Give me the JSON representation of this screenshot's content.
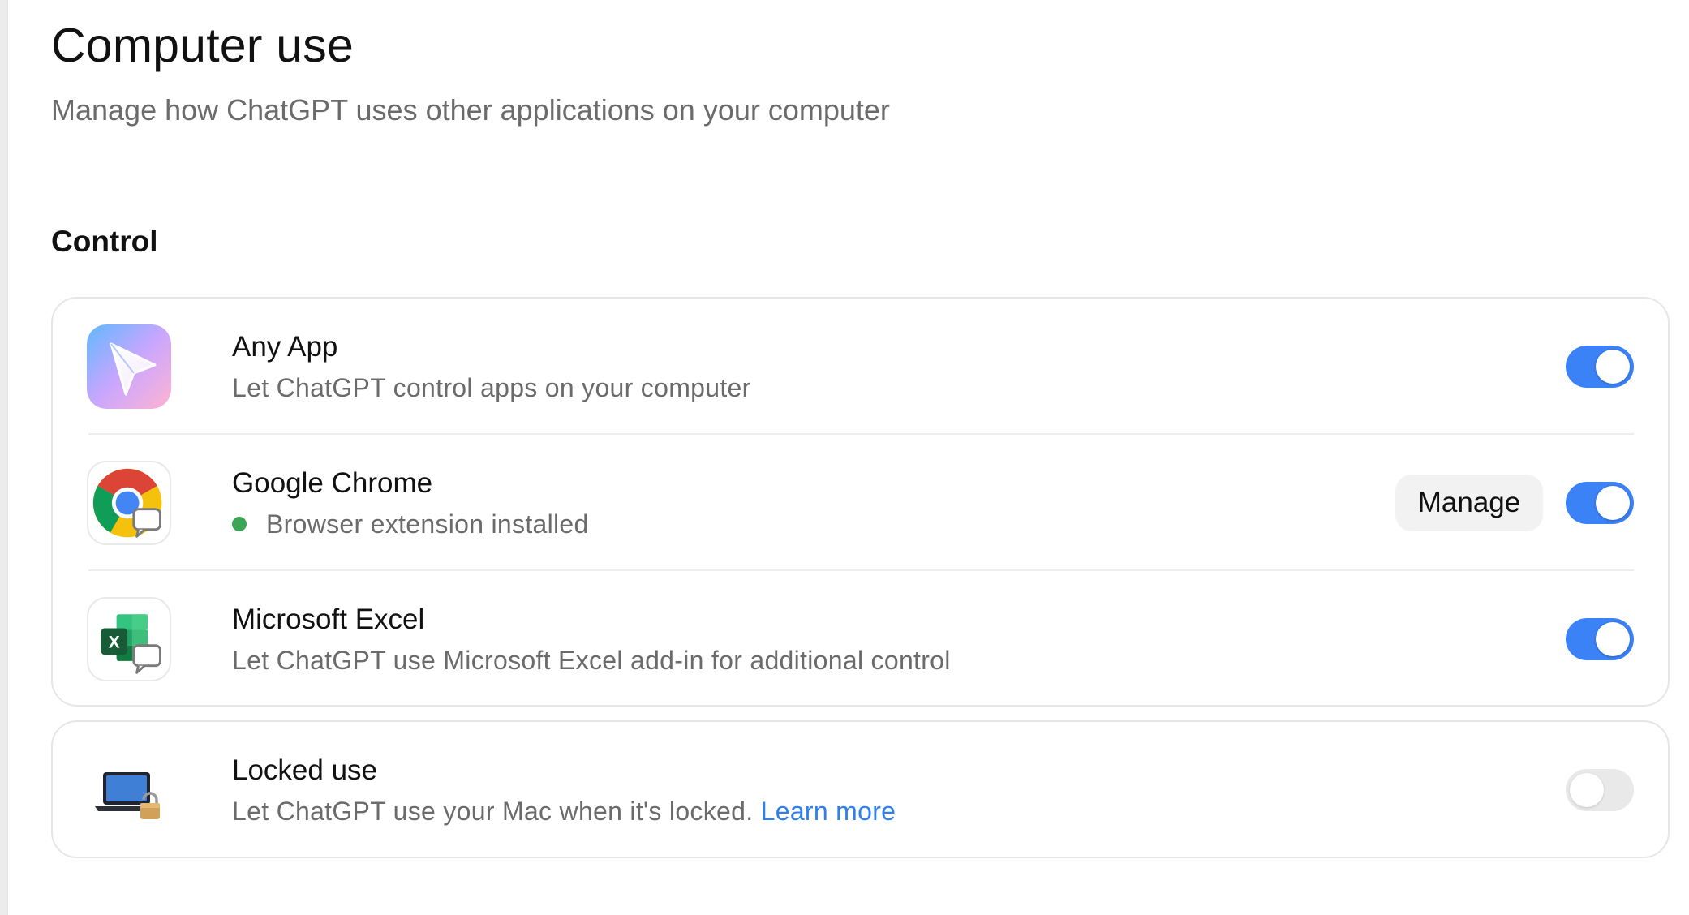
{
  "header": {
    "title": "Computer use",
    "subtitle": "Manage how ChatGPT uses other applications on your computer"
  },
  "sections": {
    "control": {
      "title": "Control",
      "items": [
        {
          "icon": "chatgpt-cursor-icon",
          "title": "Any App",
          "description": "Let ChatGPT control apps on your computer",
          "enabled": true
        },
        {
          "icon": "google-chrome-icon",
          "title": "Google Chrome",
          "description": "Browser extension installed",
          "status_color": "#3aa655",
          "manage_label": "Manage",
          "enabled": true
        },
        {
          "icon": "microsoft-excel-icon",
          "title": "Microsoft Excel",
          "description": "Let ChatGPT use Microsoft Excel add-in for additional control",
          "enabled": true
        }
      ]
    },
    "locked": {
      "icon": "locked-laptop-icon",
      "title": "Locked use",
      "description": "Let ChatGPT use your Mac when it's locked.",
      "link_label": "Learn more",
      "enabled": false
    }
  },
  "colors": {
    "toggle_on": "#3b82f6",
    "toggle_off": "#e9e9ea",
    "link": "#2f80ed"
  }
}
